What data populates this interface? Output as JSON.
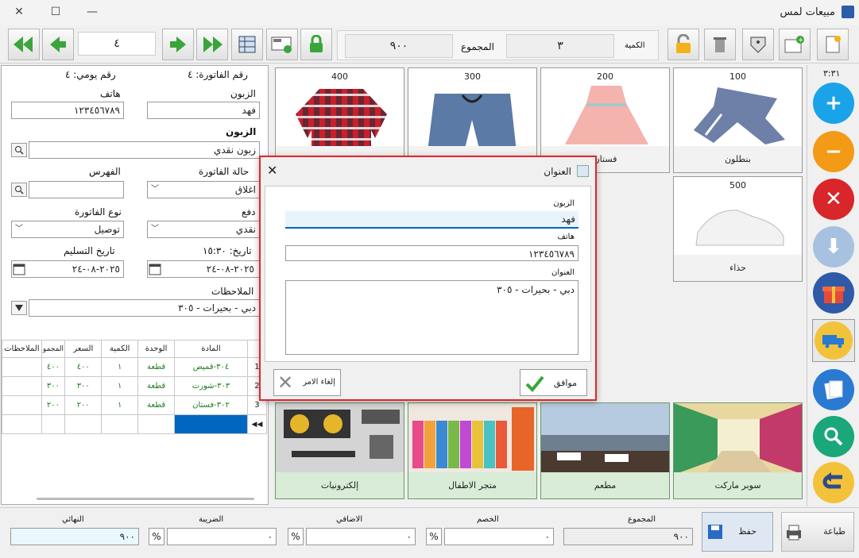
{
  "window": {
    "title": "مبيعات لمس",
    "min": "—",
    "max": "☐",
    "close": "✕"
  },
  "toolbar": {
    "record_number": "٤",
    "total_label": "المجموع",
    "total_value": "٩٠٠",
    "qty_label": "الكمية",
    "qty_value": "٣"
  },
  "invoice": {
    "invoice_no_label": "رقم الفاتورة: ٤",
    "daily_no_label": "رقم يومي: ٤",
    "customer_label": "الزبون",
    "customer_value": "فهد",
    "phone_label": "هاتف",
    "phone_value": "١٢٣٤٥٦٧٨٩",
    "customer_section_label": "الزبون",
    "customer_section_value": "زبون نقدي",
    "status_label": "حالة الفاتورة",
    "status_value": "اغلاق",
    "index_label": "الفهرس",
    "index_value": "",
    "pay_label": "دفع",
    "pay_value": "نقدي",
    "type_label": "نوع الفاتورة",
    "type_value": "توصيل",
    "date_label": "تاريخ: ١٥:٣٠",
    "date_value": "٢٠٢٥-٠٨-٢٤",
    "delivery_label": "تاريخ التسليم",
    "delivery_value": "٢٠٢٥-٠٨-٢٤",
    "notes_label": "الملاحظات",
    "notes_value": "دبي - بحيرات - ٣٠٥"
  },
  "grid": {
    "headers": {
      "item": "المادة",
      "unit": "الوحدة",
      "qty": "الكمية",
      "price": "السعر",
      "total": "المجمو",
      "notes": "الملاحظات"
    },
    "rows": [
      {
        "n": "1",
        "item": "٣٠٤-قميص",
        "unit": "قطعة",
        "qty": "١",
        "price": "٤٠٠",
        "total": "٤٠٠"
      },
      {
        "n": "2",
        "item": "٣٠٣-شورت",
        "unit": "قطعة",
        "qty": "١",
        "price": "٣٠٠",
        "total": "٣٠٠"
      },
      {
        "n": "3",
        "item": "٣٠٢-فستان",
        "unit": "قطعة",
        "qty": "١",
        "price": "٢٠٠",
        "total": "٢٠٠"
      }
    ]
  },
  "products": [
    {
      "price": "400",
      "name": "قميص"
    },
    {
      "price": "300",
      "name": "شورت"
    },
    {
      "price": "200",
      "name": "فستان"
    },
    {
      "price": "100",
      "name": "بنطلون"
    },
    {
      "price": "500",
      "name": "حذاء"
    }
  ],
  "categories": [
    {
      "name": "إلكترونيات"
    },
    {
      "name": "متجر الاطفال"
    },
    {
      "name": "مطعم"
    },
    {
      "name": "سوبر ماركت"
    }
  ],
  "side": {
    "clock": "٣:٣١"
  },
  "dialog": {
    "title": "العنوان",
    "customer_label": "الزبون",
    "customer_value": "فهد",
    "phone_label": "هاتف",
    "phone_value": "١٢٣٤٥٦٧٨٩",
    "address_label": "العنوان",
    "address_value": "دبي - بحيرات - ٣٠٥",
    "ok_label": "موافق",
    "cancel_label": "إلغاء الامر"
  },
  "bottom": {
    "total_label": "المجموع",
    "total_value": "٩٠٠",
    "discount_label": "الخصم",
    "discount_value": "٠",
    "extra_label": "الاضافي",
    "extra_value": "٠",
    "tax_label": "الضريبة",
    "tax_value": "٠",
    "final_label": "النهائي",
    "final_value": "٩٠٠",
    "pct": "%",
    "save_label": "حفظ",
    "print_label": "طباعة"
  },
  "colors": {
    "dialog_border": "#e0262a",
    "accent": "#0067c0",
    "green_text": "#1e7b1e"
  }
}
